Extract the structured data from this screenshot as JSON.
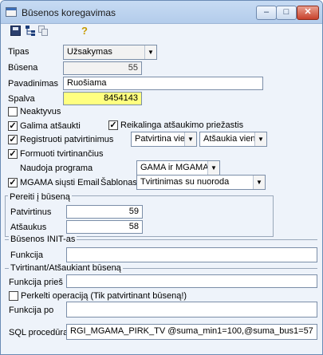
{
  "window": {
    "title": "Būsenos koregavimas"
  },
  "toolbar": {
    "icons": [
      "save-icon",
      "tree-icon",
      "copy-icon",
      "help-icon"
    ]
  },
  "form": {
    "tipas_label": "Tipas",
    "tipas_value": "Užsakymas",
    "busena_label": "Būsena",
    "busena_value": "55",
    "pavadinimas_label": "Pavadinimas",
    "pavadinimas_value": "Ruošiama",
    "spalva_label": "Spalva",
    "spalva_value": "8454143",
    "spalva_color": "#ffff80",
    "neaktyvus_label": "Neaktyvus",
    "neaktyvus_checked": false,
    "galima_label": "Galima atšaukti",
    "galima_checked": true,
    "reikalinga_label": "Reikalinga atšaukimo priežastis",
    "reikalinga_checked": true,
    "registruoti_label": "Registruoti patvirtinimus",
    "registruoti_checked": true,
    "patvirtina_value": "Patvirtina vienas",
    "atsaukia_value": "Atšaukia vienas",
    "formuoti_label": "Formuoti tvirtinančius",
    "formuoti_checked": true,
    "naudoja_label": "Naudoja programa",
    "naudoja_value": "GAMA ir MGAMA",
    "mgama_label": "MGAMA siųsti Email",
    "mgama_checked": true,
    "sablonas_label": "Šablonas",
    "sablonas_value": "Tvirtinimas su nuoroda"
  },
  "pereiti": {
    "title": "Pereiti į būseną",
    "patvirtinus_label": "Patvirtinus",
    "patvirtinus_value": "59",
    "atsaukus_label": "Atšaukus",
    "atsaukus_value": "58"
  },
  "init": {
    "title": "Būsenos INIT-as",
    "funkcija_label": "Funkcija",
    "funkcija_value": ""
  },
  "tvirtinant": {
    "title": "Tvirtinant/Atšaukiant būseną",
    "pries_label": "Funkcija prieš",
    "pries_value": "",
    "perkelti_label": "Perkelti operaciją (Tik patvirtinant būseną!)",
    "perkelti_checked": false,
    "po_label": "Funkcija po",
    "po_value": ""
  },
  "sql": {
    "label": "SQL procedūra",
    "value": "RGI_MGAMA_PIRK_TV @suma_min1=100,@suma_bus1=57"
  }
}
